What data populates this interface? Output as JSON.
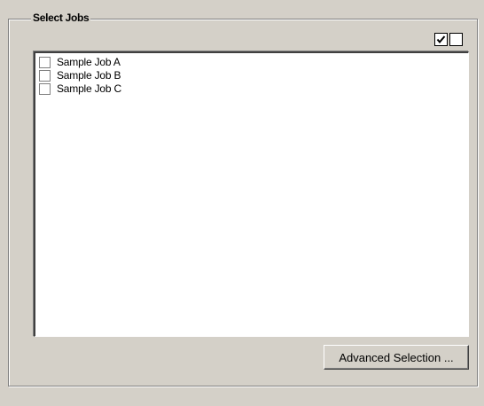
{
  "group": {
    "title": "Select Jobs"
  },
  "toolbar": {
    "select_all_icon": "checked-box-icon",
    "clear_all_icon": "empty-box-icon"
  },
  "jobs": {
    "items": [
      {
        "label": "Sample Job A",
        "checked": false
      },
      {
        "label": "Sample Job B",
        "checked": false
      },
      {
        "label": "Sample Job C",
        "checked": false
      }
    ]
  },
  "actions": {
    "advanced_selection_label": "Advanced Selection ..."
  },
  "colors": {
    "window_bg": "#d4d0c8",
    "list_bg": "#ffffff"
  }
}
